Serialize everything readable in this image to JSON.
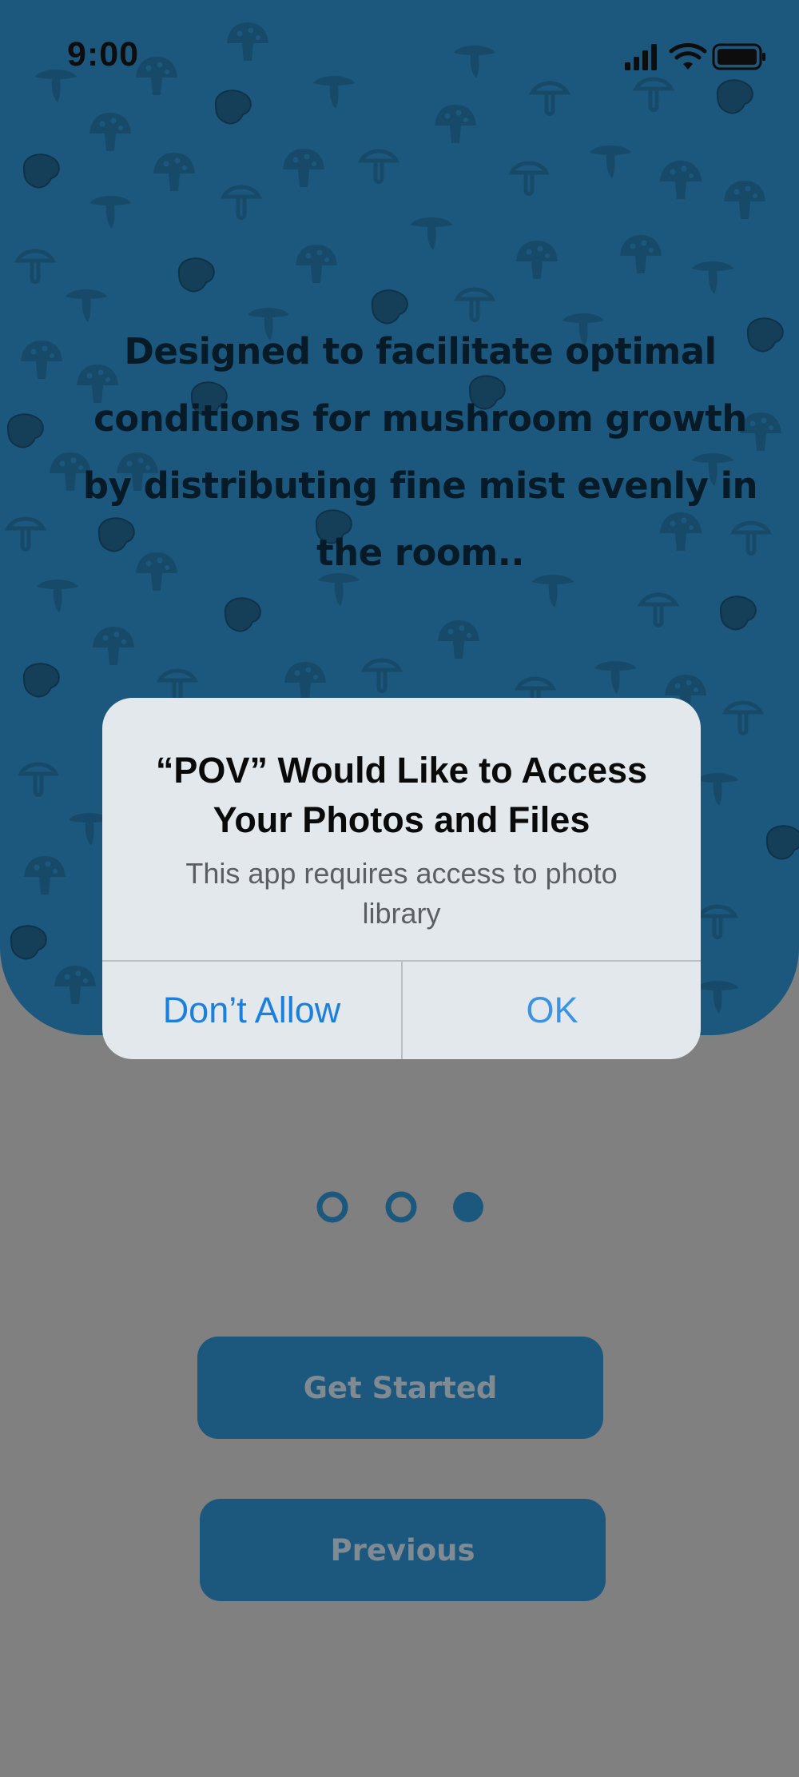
{
  "status_bar": {
    "time": "9:00"
  },
  "hero": {
    "description": "Designed to facilitate optimal conditions for mushroom growth by distributing fine mist evenly in the room.."
  },
  "alert": {
    "title": "“POV” Would Like to Access Your Photos and Files",
    "message": "This app requires access to photo library",
    "deny_label": "Don’t Allow",
    "ok_label": "OK"
  },
  "pager": {
    "total": 3,
    "active_index": 2
  },
  "buttons": {
    "get_started_label": "Get Started",
    "previous_label": "Previous"
  },
  "colors": {
    "hero_background": "#1c587d",
    "overlay_background": "#808080",
    "alert_background": "#e3e8ec",
    "alert_button_text": "#1a7fde"
  }
}
